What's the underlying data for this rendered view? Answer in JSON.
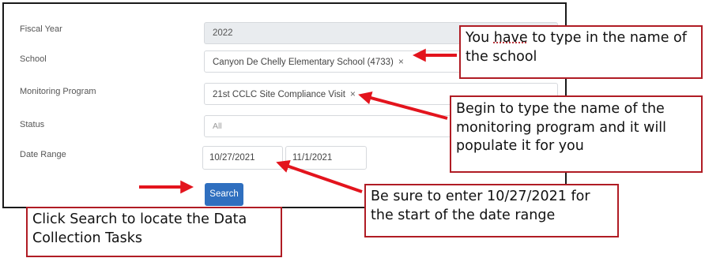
{
  "form": {
    "fiscal_year": {
      "label": "Fiscal Year",
      "value": "2022"
    },
    "school": {
      "label": "School",
      "value": "Canyon De Chelly Elementary School (4733)",
      "remove_glyph": "×"
    },
    "monitoring_program": {
      "label": "Monitoring Program",
      "value": "21st CCLC Site Compliance Visit",
      "remove_glyph": "×"
    },
    "status": {
      "label": "Status",
      "placeholder": "All"
    },
    "date_range": {
      "label": "Date Range",
      "start": "10/27/2021",
      "end": "11/1/2021"
    },
    "search_label": "Search",
    "search_button_color": "#2f6fbf"
  },
  "callouts": {
    "school": {
      "pre": "You ",
      "underlined": "have",
      "post": " to type in the name of the school"
    },
    "monitoring_program": "Begin to type the name of the monitoring program and it will populate it for you",
    "date": "Be sure to enter 10/27/2021 for the start of the date range",
    "search": "Click Search to locate the Data Collection Tasks"
  },
  "colors": {
    "callout_border": "#b01c24",
    "arrow": "#e3141d",
    "panel_border": "#1a1a1a"
  }
}
